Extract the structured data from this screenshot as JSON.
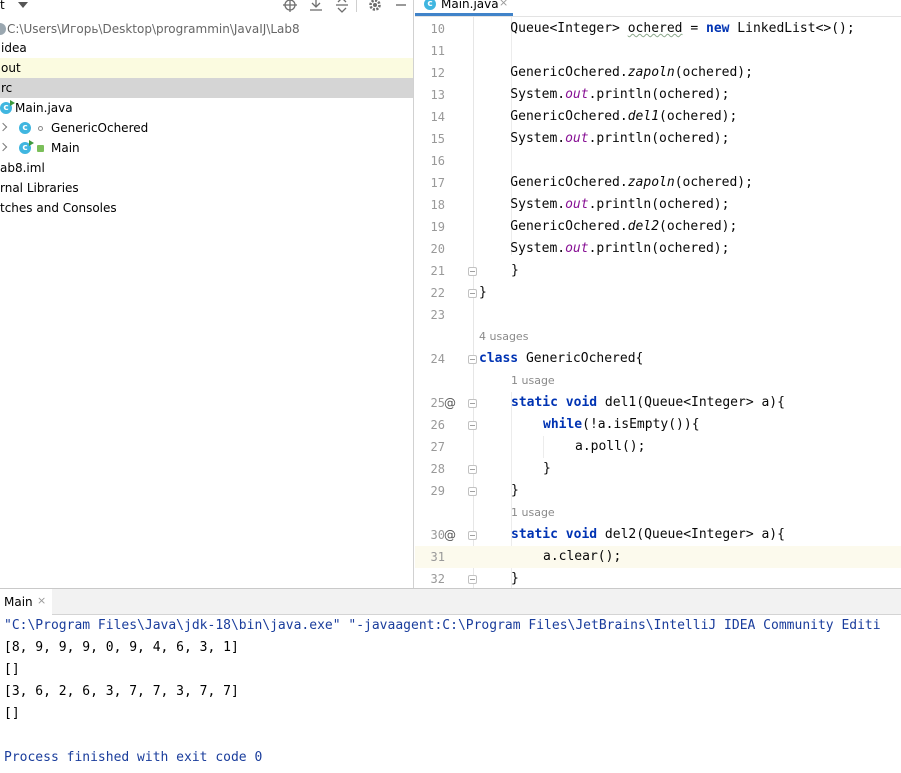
{
  "project_panel": {
    "toolbar_label": "t",
    "path": "C:\\Users\\Игорь\\Desktop\\programmin\\JavaIJ\\Lab8",
    "items": [
      {
        "label": "idea"
      },
      {
        "label": "out"
      },
      {
        "label": "rc"
      },
      {
        "label": "Main.java"
      },
      {
        "label": "GenericOchered"
      },
      {
        "label": "Main"
      },
      {
        "label": "ab8.iml"
      },
      {
        "label": "rnal Libraries"
      },
      {
        "label": "tches and Consoles"
      }
    ]
  },
  "editor": {
    "tab_label": "Main.java",
    "tab_close": "×",
    "hints": {
      "h23": "4 usages",
      "h24": "1 usage",
      "h29": "1 usage"
    },
    "lines": [
      {
        "n": "10",
        "t1": "    Queue<Integer> ",
        "t2": "ochered",
        "t3": " = ",
        "t4": "new",
        "t5": " LinkedList<>();"
      },
      {
        "n": "11"
      },
      {
        "n": "12",
        "a": "    GenericOchered.",
        "b": "zapoln",
        "c": "(ochered);"
      },
      {
        "n": "13",
        "a": "    System.",
        "b": "out",
        "c": ".println(ochered);"
      },
      {
        "n": "14",
        "a": "    GenericOchered.",
        "b": "del1",
        "c": "(ochered);"
      },
      {
        "n": "15",
        "a": "    System.",
        "b": "out",
        "c": ".println(ochered);"
      },
      {
        "n": "16"
      },
      {
        "n": "17",
        "a": "    GenericOchered.",
        "b": "zapoln",
        "c": "(ochered);"
      },
      {
        "n": "18",
        "a": "    System.",
        "b": "out",
        "c": ".println(ochered);"
      },
      {
        "n": "19",
        "a": "    GenericOchered.",
        "b": "del2",
        "c": "(ochered);"
      },
      {
        "n": "20",
        "a": "    System.",
        "b": "out",
        "c": ".println(ochered);"
      },
      {
        "n": "21",
        "code": "}"
      },
      {
        "n": "22",
        "code": "}"
      },
      {
        "n": "23"
      },
      {
        "n": "24",
        "kw": "class",
        "code": " GenericOchered{",
        "sq": "GenericOchered"
      },
      {
        "n": "25",
        "at": "@",
        "kw1": "static",
        "kw2": "void",
        "code": " del1(Queue<Integer> a){"
      },
      {
        "n": "26",
        "kw": "while",
        "code": "(!a.isEmpty()){"
      },
      {
        "n": "27",
        "code": "a.poll();"
      },
      {
        "n": "28",
        "code": "}"
      },
      {
        "n": "29",
        "code": "}"
      },
      {
        "n": "30",
        "at": "@",
        "kw1": "static",
        "kw2": "void",
        "code": " del2(Queue<Integer> a){"
      },
      {
        "n": "31",
        "code": "a.clear();"
      },
      {
        "n": "32",
        "code": "}"
      }
    ]
  },
  "run_panel": {
    "tab_label": "Main",
    "tab_close": "×",
    "console": {
      "cmd": "\"C:\\Program Files\\Java\\jdk-18\\bin\\java.exe\" \"-javaagent:C:\\Program Files\\JetBrains\\IntelliJ IDEA Community Editi",
      "out1": "[8, 9, 9, 9, 0, 9, 4, 6, 3, 1]",
      "out2": "[]",
      "out3": "[3, 6, 2, 6, 3, 7, 7, 3, 7, 7]",
      "out4": "[]",
      "exit": "Process finished with exit code 0"
    }
  },
  "colors": {
    "keyword": "#0033b3",
    "static_field": "#871094",
    "tab_underline": "#4083c9",
    "selection_grey": "#d5d5d5",
    "highlight_yellow": "#fbfbe0"
  },
  "icons": [
    "crosshair-icon",
    "expand-all-icon",
    "collapse-all-icon",
    "gear-icon",
    "minimize-icon",
    "class-icon",
    "chevron-right-icon"
  ]
}
